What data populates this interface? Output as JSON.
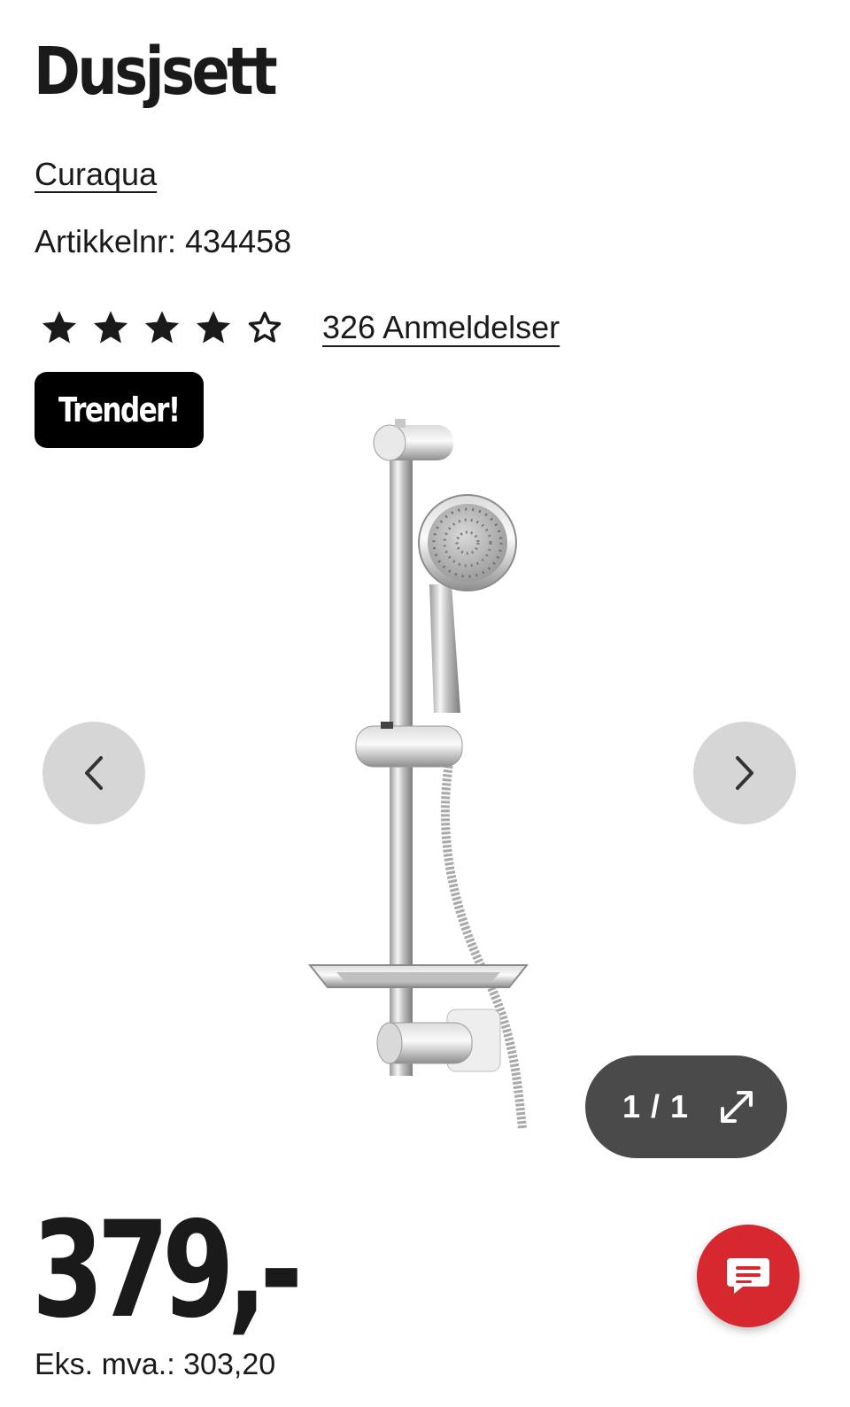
{
  "product": {
    "title": "Dusjsett",
    "brand": "Curaqua",
    "sku_text": "Artikkelnr: 434458",
    "rating": {
      "stars": 4,
      "max": 5,
      "reviews_text": "326 Anmeldelser"
    },
    "badge": "Trender!"
  },
  "gallery": {
    "counter": "1 / 1",
    "prev_icon": "chevron-left-icon",
    "next_icon": "chevron-right-icon",
    "expand_icon": "expand-icon"
  },
  "pricing": {
    "price": "379,-",
    "ex_vat": "Eks. mva.: 303,20"
  },
  "chat": {
    "icon": "chat-icon",
    "color": "#d7282f"
  }
}
